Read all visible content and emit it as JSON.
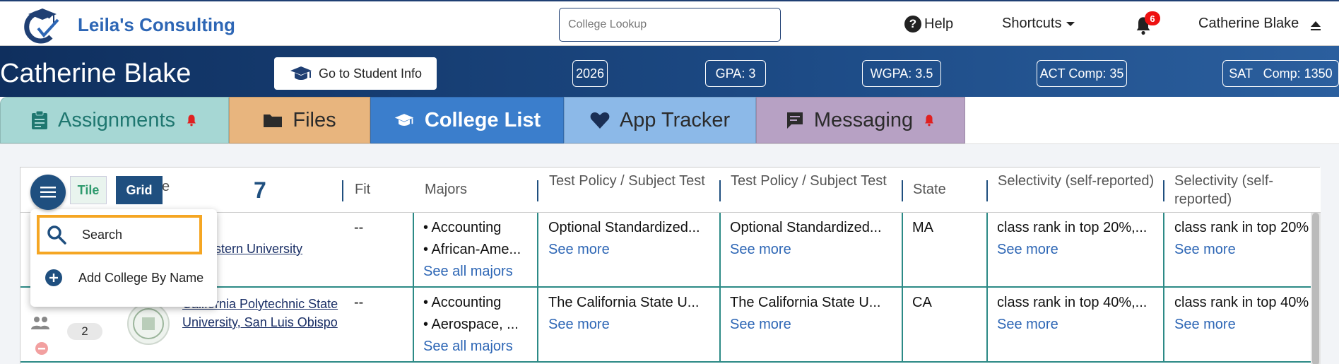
{
  "app": {
    "brand": "Leila's Consulting"
  },
  "header": {
    "lookup_placeholder": "College Lookup",
    "help_label": "Help",
    "shortcuts_label": "Shortcuts",
    "notification_count": "6",
    "user_name": "Catherine Blake"
  },
  "student": {
    "name": "Catherine Blake",
    "go_button": "Go to Student Info",
    "stats": [
      "2026",
      "GPA: 3",
      "WGPA: 3.5",
      "ACT Comp: 35",
      "SAT   Comp: 1350"
    ]
  },
  "tabs": [
    {
      "label": "Assignments"
    },
    {
      "label": "Files"
    },
    {
      "label": "College List"
    },
    {
      "label": "App Tracker"
    },
    {
      "label": "Messaging"
    }
  ],
  "view_toggle": {
    "tile": "Tile",
    "grid": "Grid"
  },
  "table": {
    "name_header_fragment": "e",
    "count": "7",
    "headers": {
      "fit": "Fit",
      "majors": "Majors",
      "test_policy_1": "Test Policy / Subject Test",
      "test_policy_2": "Test Policy / Subject Test",
      "state": "State",
      "selectivity_1": "Selectivity (self-reported)",
      "selectivity_2": "Selectivity (self-reported)"
    },
    "rows": [
      {
        "university": "eastern University",
        "fit": "--",
        "major1": "• Accounting",
        "major2": "• African-Ame...",
        "see_all": "See all majors",
        "policy1": "Optional Standardized...",
        "policy2": "Optional Standardized...",
        "see_more": "See more",
        "state": "MA",
        "select1": "class rank in top 20%,...",
        "select2": "class rank in top 20%"
      },
      {
        "rank": "2",
        "university": "California Polytechnic State University, San Luis Obispo",
        "fit": "--",
        "major1": "• Accounting",
        "major2": "• Aerospace, ...",
        "see_all": "See all majors",
        "policy1": "The California State U...",
        "policy2": "The California State U...",
        "see_more": "See more",
        "state": "CA",
        "select1": "class rank in top 40%,...",
        "select2": "class rank in top 40%"
      }
    ]
  },
  "menu": {
    "search": "Search",
    "add_college": "Add College By Name"
  },
  "colors": {
    "navy": "#1f4f7f",
    "brand_blue": "#2d66b5",
    "teal": "#2c8a86",
    "highlight": "#f5a623"
  }
}
